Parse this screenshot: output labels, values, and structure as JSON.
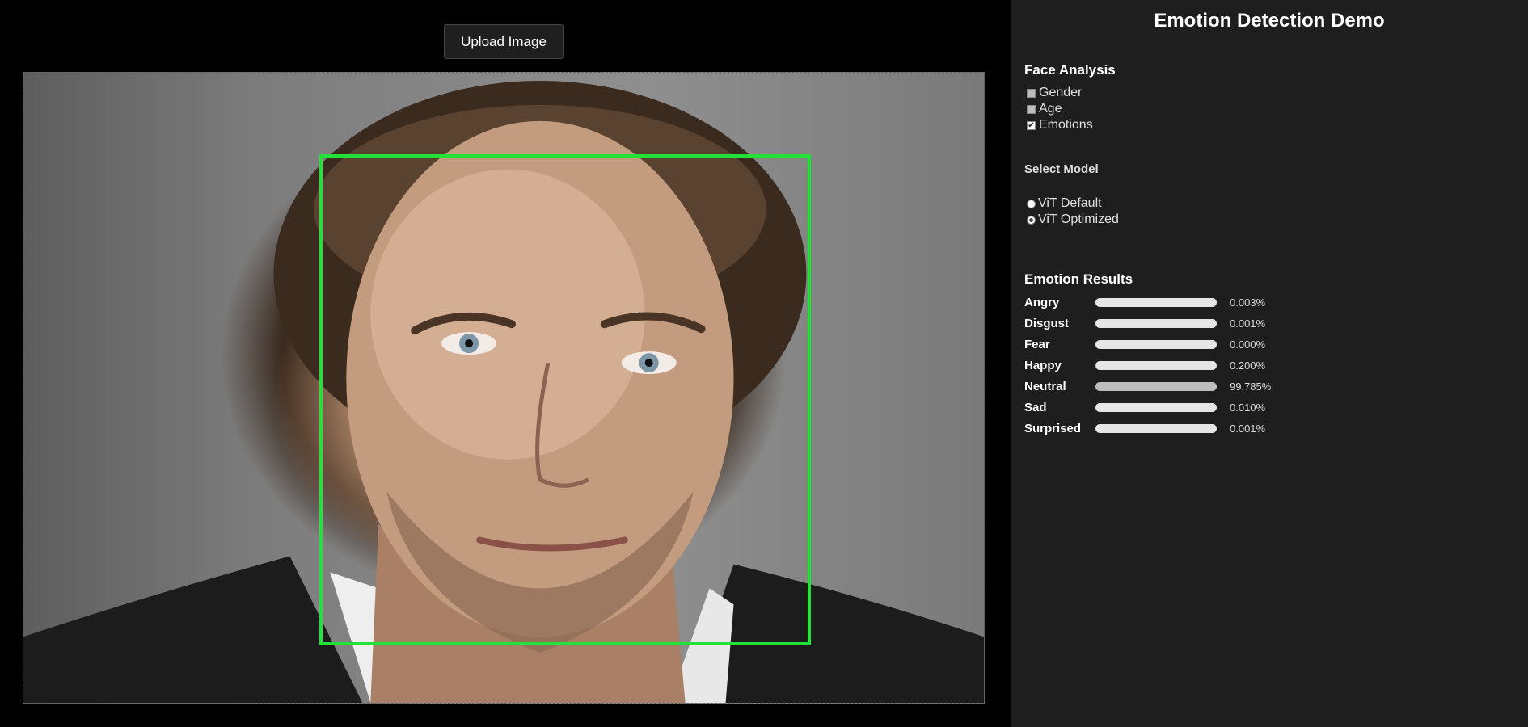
{
  "left": {
    "upload_label": "Upload Image"
  },
  "sidebar": {
    "title": "Emotion Detection Demo",
    "face_analysis": {
      "heading": "Face Analysis",
      "options": [
        {
          "label": "Gender",
          "checked": false
        },
        {
          "label": "Age",
          "checked": false
        },
        {
          "label": "Emotions",
          "checked": true
        }
      ]
    },
    "model": {
      "heading": "Select Model",
      "options": [
        {
          "label": "ViT Default",
          "selected": false
        },
        {
          "label": "ViT Optimized",
          "selected": true
        }
      ]
    },
    "results": {
      "heading": "Emotion Results",
      "rows": [
        {
          "name": "Angry",
          "value": "0.003%",
          "fraction": 3e-05
        },
        {
          "name": "Disgust",
          "value": "0.001%",
          "fraction": 1e-05
        },
        {
          "name": "Fear",
          "value": "0.000%",
          "fraction": 0.0
        },
        {
          "name": "Happy",
          "value": "0.200%",
          "fraction": 0.002
        },
        {
          "name": "Neutral",
          "value": "99.785%",
          "fraction": 0.99785
        },
        {
          "name": "Sad",
          "value": "0.010%",
          "fraction": 0.0001
        },
        {
          "name": "Surprised",
          "value": "0.001%",
          "fraction": 1e-05
        }
      ]
    }
  },
  "colors": {
    "face_box": "#22e23a",
    "sidebar_bg": "#1e1e1e",
    "bar_track": "#e6e6e6",
    "bar_highlight": "#8a8a8a"
  }
}
